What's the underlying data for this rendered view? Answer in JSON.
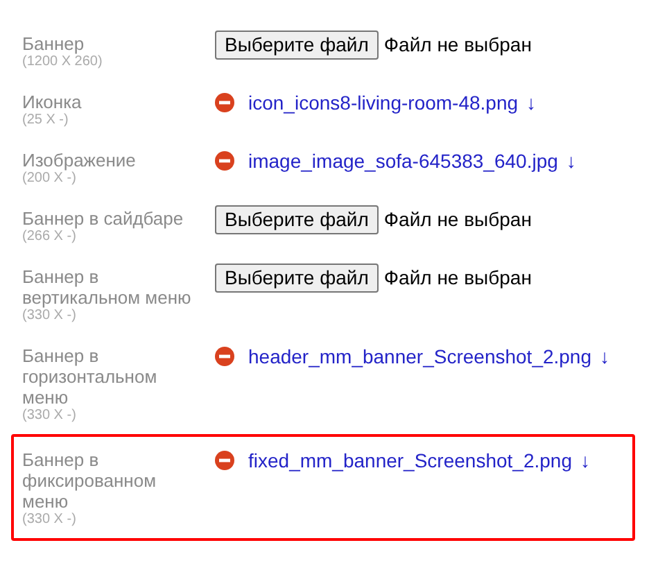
{
  "fields": [
    {
      "label": "Баннер",
      "size": "(1200 X 260)",
      "kind": "file_input",
      "button": "Выберите файл",
      "status": "Файл не выбран",
      "highlighted": false
    },
    {
      "label": "Иконка",
      "size": "(25 X -)",
      "kind": "uploaded",
      "file": "icon_icons8-living-room-48.png",
      "arrow": "↓",
      "highlighted": false
    },
    {
      "label": "Изображение",
      "size": "(200 X -)",
      "kind": "uploaded",
      "file": "image_image_sofa-645383_640.jpg",
      "arrow": "↓",
      "highlighted": false
    },
    {
      "label": "Баннер в сайдбаре",
      "size": "(266 X -)",
      "kind": "file_input",
      "button": "Выберите файл",
      "status": "Файл не выбран",
      "highlighted": false
    },
    {
      "label": "Баннер в вертикальном меню",
      "size": "(330 X -)",
      "kind": "file_input",
      "button": "Выберите файл",
      "status": "Файл не выбран",
      "highlighted": false
    },
    {
      "label": "Баннер в горизонтальном меню",
      "size": "(330 X -)",
      "kind": "uploaded",
      "file": "header_mm_banner_Screenshot_2.png",
      "arrow": "↓",
      "highlighted": false
    },
    {
      "label": "Баннер в фиксированном меню",
      "size": "(330 X -)",
      "kind": "uploaded",
      "file": "fixed_mm_banner_Screenshot_2.png",
      "arrow": "↓",
      "highlighted": true
    }
  ]
}
